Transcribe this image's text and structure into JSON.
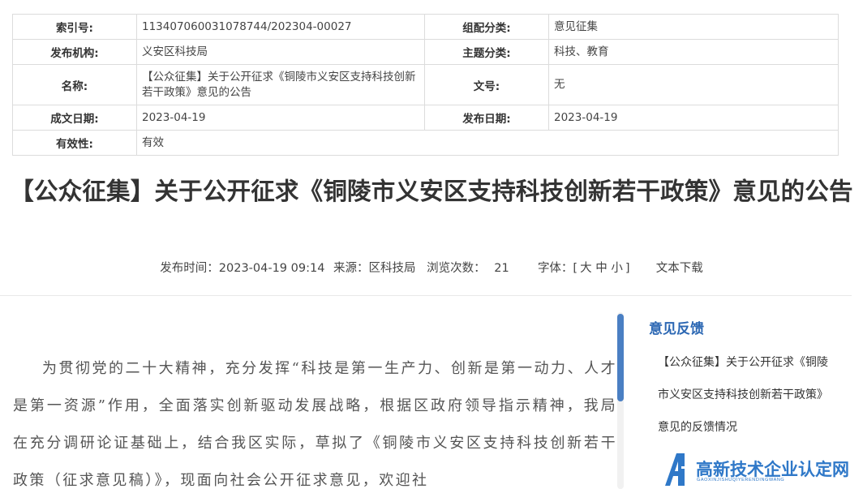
{
  "meta": {
    "index_label": "索引号:",
    "index_value": "113407060031078744/202304-00027",
    "group_label": "组配分类:",
    "group_value": "意见征集",
    "org_label": "发布机构:",
    "org_value": "义安区科技局",
    "topic_label": "主题分类:",
    "topic_value": "科技、教育",
    "name_label": "名称:",
    "name_value": "【公众征集】关于公开征求《铜陵市义安区支持科技创新若干政策》意见的公告",
    "docno_label": "文号:",
    "docno_value": "无",
    "created_label": "成文日期:",
    "created_value": "2023-04-19",
    "published_label": "发布日期:",
    "published_value": "2023-04-19",
    "validity_label": "有效性:",
    "validity_value": "有效"
  },
  "title": "【公众征集】关于公开征求《铜陵市义安区支持科技创新若干政策》意见的公告",
  "info": {
    "time": "发布时间：2023-04-19 09:14",
    "source": "来源：区科技局",
    "views_label": "浏览次数：",
    "views_value": "21",
    "font_label": "字体：[",
    "font_large": "大",
    "font_medium": "中",
    "font_small": "小",
    "font_close": "]",
    "download": "文本下载"
  },
  "body": {
    "paragraph": "为贯彻党的二十大精神，充分发挥“科技是第一生产力、创新是第一动力、人才是第一资源”作用，全面落实创新驱动发展战略，根据区政府领导指示精神，我局在充分调研论证基础上，结合我区实际，草拟了《铜陵市义安区支持科技创新若干政策（征求意见稿）》，现面向社会公开征求意见，欢迎社"
  },
  "sidebar": {
    "title": "意见反馈",
    "link": "【公众征集】关于公开征求《铜陵市义安区支持科技创新若干政策》意见的反馈情况"
  },
  "watermark": {
    "text": "高新技术企业认定网",
    "sub": "GAOXINJISHUQIYERENDINGWANG"
  },
  "colors": {
    "accent": "#2b67b3",
    "scroll_thumb": "#4a7fc3",
    "border": "#dcdcdc"
  }
}
